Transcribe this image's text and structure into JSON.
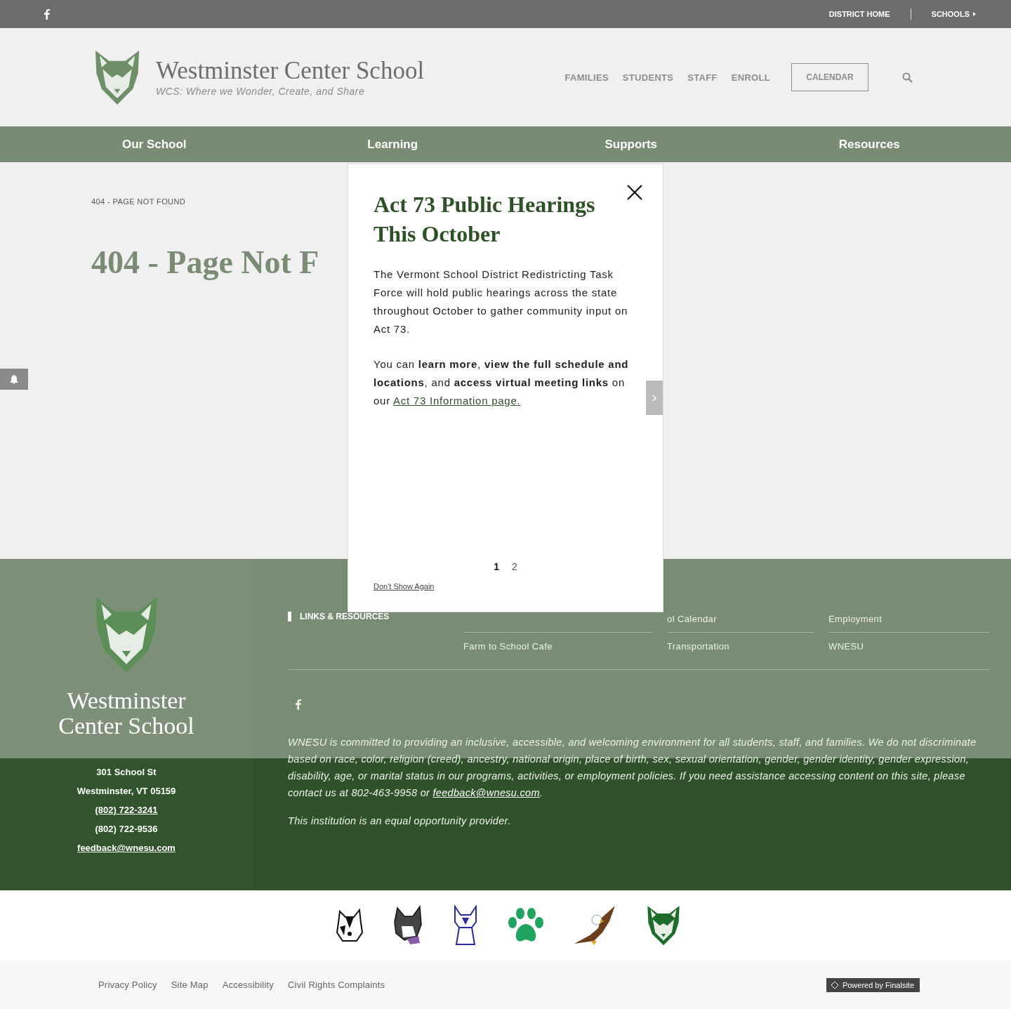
{
  "top_bar": {
    "links": [
      "DISTRICT HOME",
      "SCHOOLS"
    ]
  },
  "header": {
    "title": "Westminster Center School",
    "tagline": "WCS: Where we Wonder, Create, and Share",
    "nav": [
      "FAMILIES",
      "STUDENTS",
      "STAFF",
      "ENROLL"
    ],
    "calendar_button": "CALENDAR"
  },
  "main_nav": [
    "Our School",
    "Learning",
    "Supports",
    "Resources"
  ],
  "breadcrumb": "404 - PAGE NOT FOUND",
  "page_title": "404 - Page Not F",
  "modal": {
    "title": "Act 73 Public Hearings This October",
    "paragraph_1": "The Vermont School District Redistricting Task Force will hold public hearings across the state throughout October to gather community input on Act 73.",
    "paragraph_2": "You can **learn more**, **view the full schedule and locations**, and **access virtual meeting links** on our",
    "link": "Act 73 Information page.",
    "pages": [
      {
        "label": "1",
        "selected": true
      },
      {
        "label": "2",
        "selected": false
      }
    ],
    "dont_show": "Don't Show Again"
  },
  "footer": {
    "school_name": "Westminster Center School",
    "address": [
      {
        "text": "301 School St",
        "link": false
      },
      {
        "text": "Westminster, VT  05159",
        "link": false
      },
      {
        "text": "(802) 722-3241",
        "link": true
      },
      {
        "text": "(802) 722-9536",
        "link": false
      },
      {
        "text": "feedback@wnesu.com",
        "link": true
      }
    ],
    "links_heading": "LINKS & RESOURCES",
    "link_columns": [
      [
        "Farm to School Cafe"
      ],
      [
        "ol Calendar",
        "Transportation"
      ],
      [
        "Employment",
        "WNESU"
      ]
    ],
    "statement": "WNESU is committed to providing an inclusive, accessible, and welcoming environment for all students, staff, and families. We do not discriminate based on race, color, religion (creed), ancestry, national origin, place of birth, sex, sexual orientation, gender, gender identity, gender expression, disability, age, or marital status in our programs, activities, or employment policies. If you need assistance accessing content on this site, please contact us at 802-463-9958 or",
    "statement_link": "feedback@wnesu.com",
    "statement_end": ".",
    "equal_opportunity": "This institution is an equal opportunity provider."
  },
  "mascots": [
    {
      "kind": "bulldog"
    },
    {
      "kind": "terrier"
    },
    {
      "kind": "puppy"
    },
    {
      "kind": "paw"
    },
    {
      "kind": "eagle"
    },
    {
      "kind": "wolf"
    }
  ],
  "bottom_links": [
    "Privacy Policy",
    "Site Map",
    "Accessibility",
    "Civil Rights Complaints"
  ],
  "powered_by": "Powered by Finalsite"
}
